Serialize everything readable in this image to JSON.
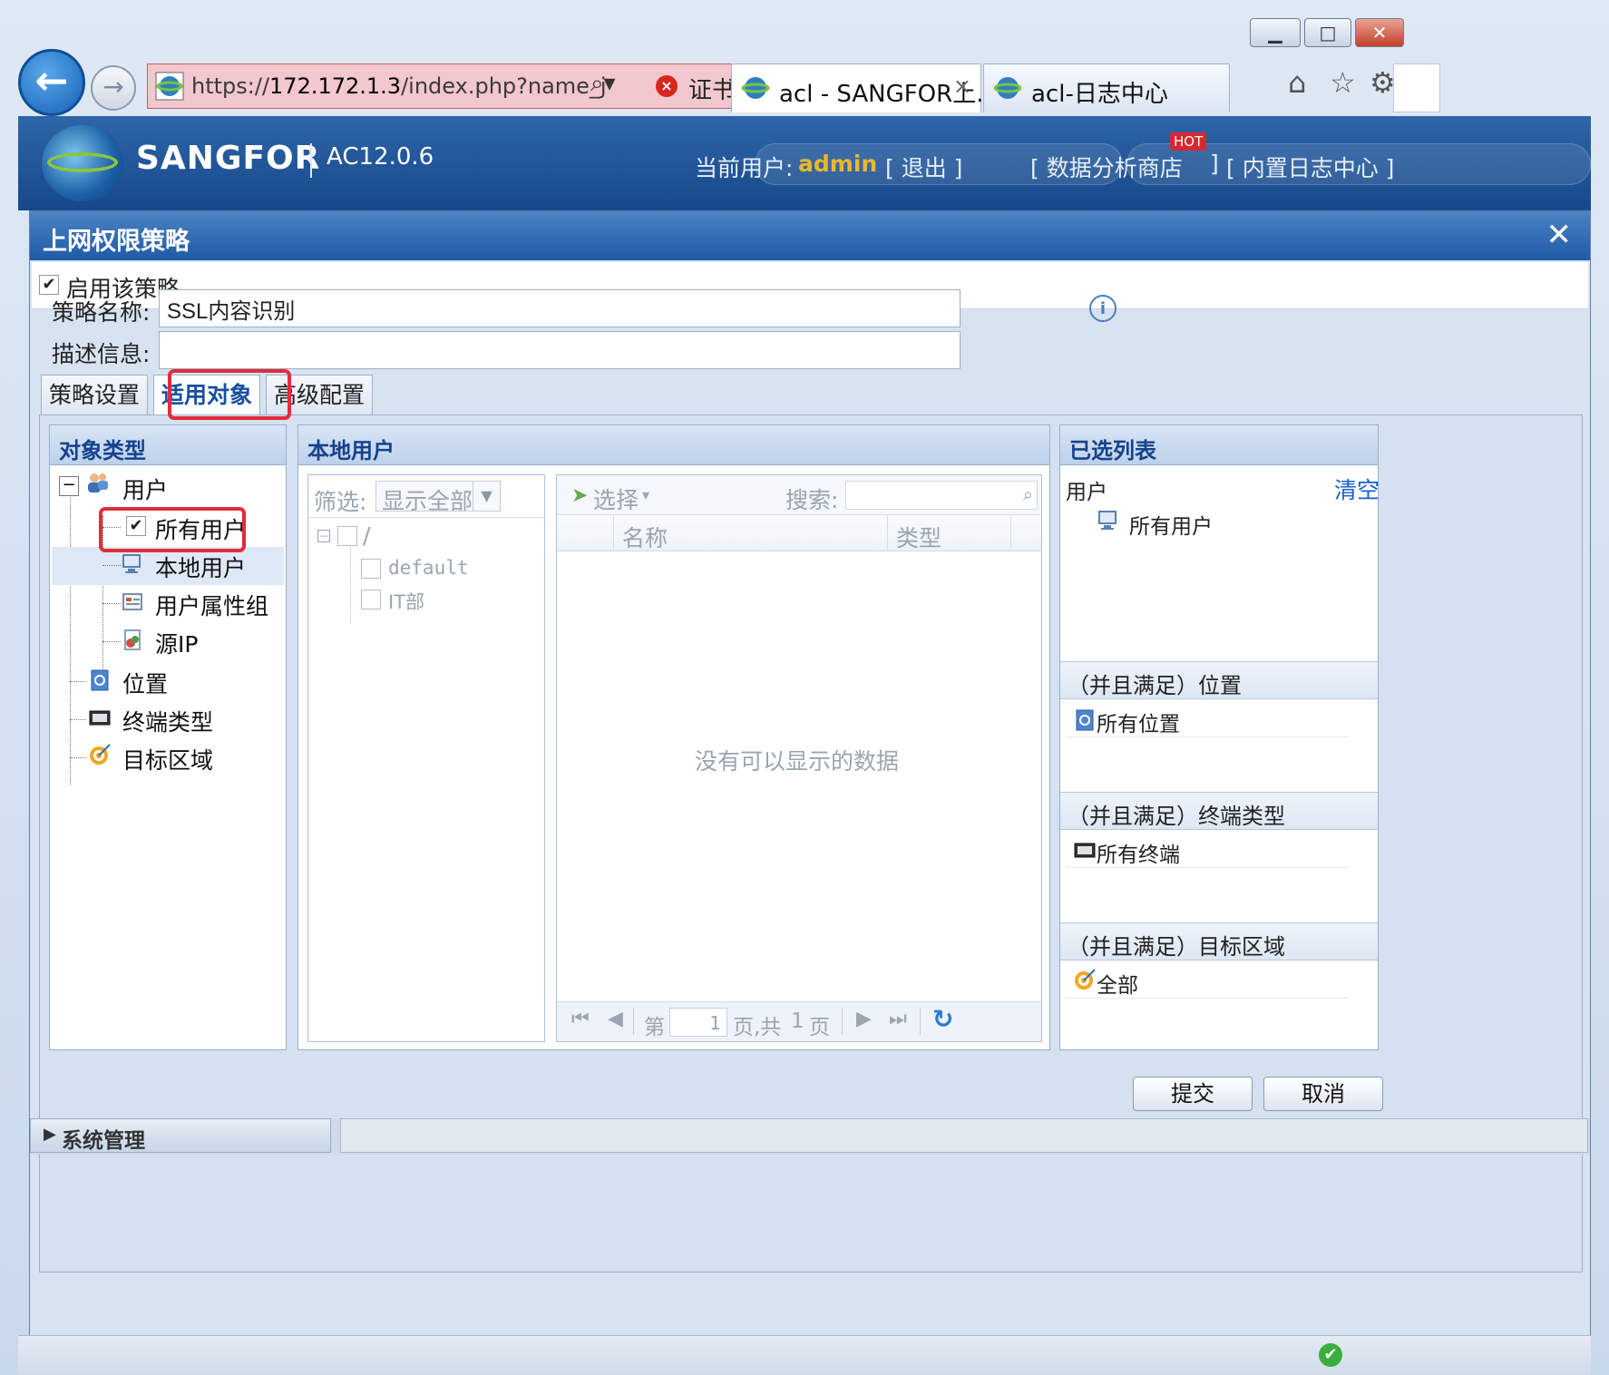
{
  "browser": {
    "window_controls": {
      "minimize": "▁",
      "maximize": "□",
      "close": "✕"
    },
    "address": {
      "url_prefix": "https://",
      "url_host": "172.172.1.3",
      "url_rest": "/index.php?name_j",
      "cert_error": "证书错误"
    },
    "tabs": [
      {
        "label": "acl - SANGFOR上...",
        "close": "×"
      },
      {
        "label": "acl-日志中心"
      }
    ]
  },
  "header": {
    "brand": "SANGFOR",
    "version": "AC12.0.6",
    "current_user_label": "当前用户:",
    "current_user": "admin",
    "logout": "[ 退出 ]",
    "data_store": "[ 数据分析商店",
    "hot": "HOT",
    "data_store_end": "]",
    "log_center": "[ 内置日志中心 ]"
  },
  "dialog": {
    "title": "上网权限策略",
    "close": "✕",
    "enable_label": "启用该策略",
    "enable_checked": true,
    "name_label": "策略名称:",
    "name_value": "SSL内容识别",
    "desc_label": "描述信息:",
    "desc_value": "",
    "tabs": [
      "策略设置",
      "适用对象",
      "高级配置"
    ],
    "active_tab": "适用对象",
    "object_panel": {
      "title": "对象类型",
      "expander": "−",
      "root": "用户",
      "children": [
        "所有用户",
        "本地用户",
        "用户属性组",
        "源IP"
      ],
      "others": [
        "位置",
        "终端类型",
        "目标区域"
      ]
    },
    "local_panel": {
      "title": "本地用户",
      "filter_label": "筛选:",
      "filter_value": "显示全部",
      "tree_root": "/",
      "tree_children": [
        "default",
        "IT部"
      ],
      "select_btn": "选择",
      "search_label": "搜索:",
      "columns": [
        "名称",
        "类型"
      ],
      "empty_text": "没有可以显示的数据",
      "pager": {
        "page_label": "第",
        "page": "1",
        "of_label": "页,共",
        "total": "1",
        "page_suffix": "页"
      }
    },
    "selected_panel": {
      "title": "已选列表",
      "user_header": "用户",
      "clear": "清空",
      "user_item": "所有用户",
      "sections": [
        {
          "title": "（并且满足）位置",
          "item": "所有位置"
        },
        {
          "title": "（并且满足）终端类型",
          "item": "所有终端"
        },
        {
          "title": "（并且满足）目标区域",
          "item": "全部"
        }
      ]
    },
    "buttons": {
      "submit": "提交",
      "cancel": "取消"
    },
    "system_menu": "系统管理"
  },
  "colors": {
    "highlight": "#e02d3b",
    "title_bar": "#1f5aa6",
    "admin": "#e7b92a",
    "link": "#1a5fc4"
  }
}
